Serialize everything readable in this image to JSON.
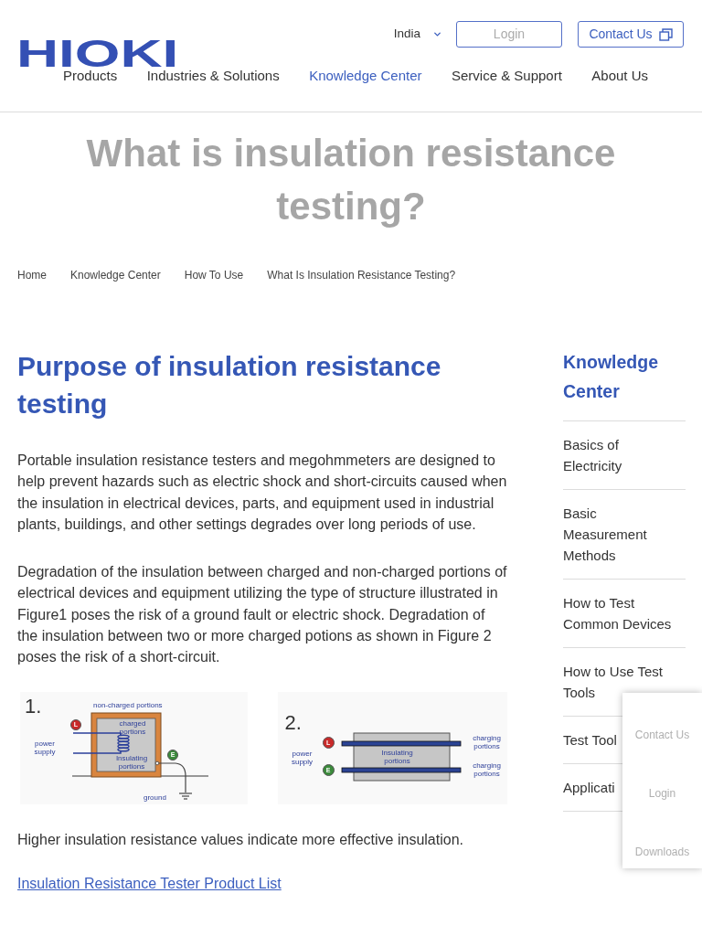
{
  "header": {
    "logo": "HIOKI",
    "region": "India",
    "login": "Login",
    "contact": "Contact Us",
    "nav": [
      {
        "label": "Products",
        "selected": false
      },
      {
        "label": "Industries & Solutions",
        "selected": false
      },
      {
        "label": "Knowledge Center",
        "selected": true
      },
      {
        "label": "Service & Support",
        "selected": false
      },
      {
        "label": "About Us",
        "selected": false
      }
    ]
  },
  "page_title": "What is insulation resistance testing?",
  "breadcrumbs": [
    "Home",
    "Knowledge Center",
    "How To Use",
    "What Is Insulation Resistance Testing?"
  ],
  "article": {
    "heading": "Purpose of insulation resistance testing",
    "paragraphs": [
      "Portable insulation resistance testers and megohmmeters are designed to help prevent hazards such as electric shock and short-circuits caused when the insulation in electrical devices, parts, and equipment used in industrial plants, buildings, and other settings degrades over long periods of use.",
      "Degradation of the insulation between charged and non-charged portions of electrical devices and equipment utilizing the type of structure illustrated in Figure1 poses the risk of a ground fault or electric shock. Degradation of the insulation between two or more charged potions as shown in Figure 2 poses the risk of a short-circuit."
    ],
    "figures": [
      {
        "kind": "enclosure",
        "number": "1.",
        "outer_label": "non-charged portions",
        "inner_label": "charged portions",
        "supply_label": "power supply",
        "insulation_label": "Insulating portions",
        "ground_label": "ground",
        "terminals": [
          {
            "letter": "L",
            "kind": "live"
          },
          {
            "letter": "E",
            "kind": "earth"
          }
        ]
      },
      {
        "kind": "parallel",
        "number": "2.",
        "supply_label": "power supply",
        "insulation_label": "Insulating portions",
        "conductor_labels": [
          "charging portions",
          "charging portions"
        ],
        "terminals": [
          {
            "letter": "L",
            "kind": "live"
          },
          {
            "letter": "E",
            "kind": "earth"
          }
        ]
      }
    ],
    "note": "Higher insulation resistance values indicate more effective insulation.",
    "link": "Insulation Resistance Tester Product List"
  },
  "sidebar": {
    "heading": "Knowledge Center",
    "items": [
      "Basics of Electricity",
      "Basic Measurement Methods",
      "How to Test Common Devices",
      "How to Use Test Tools",
      "Test Tool",
      "Applicati"
    ]
  },
  "floating_menu": [
    "Contact Us",
    "Login",
    "Downloads"
  ]
}
